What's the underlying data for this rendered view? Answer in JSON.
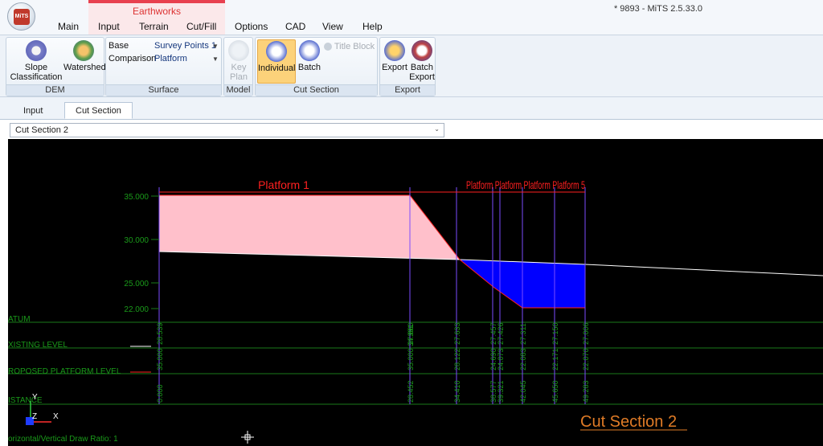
{
  "app": {
    "window_title": "* 9893 - MiTS 2.5.33.0",
    "logo_text": "MiTS",
    "context_tab_group": "Earthworks",
    "tabs": [
      "Main",
      "Input",
      "Terrain",
      "Cut/Fill",
      "Options",
      "CAD",
      "View",
      "Help"
    ]
  },
  "ribbon": {
    "dem": {
      "label": "DEM",
      "slope_line1": "Slope",
      "slope_line2": "Classification",
      "watershed": "Watershed"
    },
    "surface": {
      "label": "Surface",
      "base_label": "Base",
      "base_value": "Survey Points 1",
      "comparison_label": "Comparison",
      "comparison_value": "Platform"
    },
    "model": {
      "label": "Model",
      "key_line1": "Key",
      "key_line2": "Plan"
    },
    "cut_section": {
      "label": "Cut Section",
      "individual": "Individual",
      "batch": "Batch",
      "title_block": "Title Block"
    },
    "export": {
      "label": "Export",
      "export": "Export",
      "batch_line1": "Batch",
      "batch_line2": "Export"
    }
  },
  "subtabs": [
    "Input",
    "Cut Section"
  ],
  "section_select": {
    "value": "Cut Section 2"
  },
  "drawing": {
    "platform_label": "Platform 1",
    "overlap_label": "Platform Platform Platform Platform 5",
    "title": "Cut Section 2",
    "elevations": [
      "35.000",
      "30.000",
      "25.000",
      "22.000"
    ],
    "rows": [
      "ATUM",
      "XISTING LEVEL",
      "ROPOSED PLATFORM LEVEL",
      "ISTANCE"
    ],
    "ratio_text": "orizontal/Vertical Draw Ratio: 1",
    "axis_y": "Y",
    "axis_z": "Z",
    "axis_x": "X",
    "stations": [
      {
        "existing": "28.539",
        "proposed": "35.000",
        "distance": "0.000"
      },
      {
        "existing": "27.860",
        "proposed": "35.000 34.991",
        "distance": "28.452"
      },
      {
        "existing": "27.633",
        "proposed": "28.122",
        "distance": "34.410"
      },
      {
        "existing": "27.457",
        "proposed": "24.690",
        "distance": "38.577"
      },
      {
        "existing": "27.426",
        "proposed": "24.073",
        "distance": "39.321"
      },
      {
        "existing": "27.311",
        "proposed": "22.083",
        "distance": "42.045"
      },
      {
        "existing": "27.150",
        "proposed": "22.171",
        "distance": "45.650"
      },
      {
        "existing": "27.006",
        "proposed": "22.070",
        "distance": "49.283"
      }
    ]
  },
  "colors": {
    "fill_area": "#ffc0cb",
    "cut_area": "#0000ff",
    "label_red": "#ff2020",
    "grid_green": "#1a7a1a",
    "title_orange": "#e07b26"
  }
}
